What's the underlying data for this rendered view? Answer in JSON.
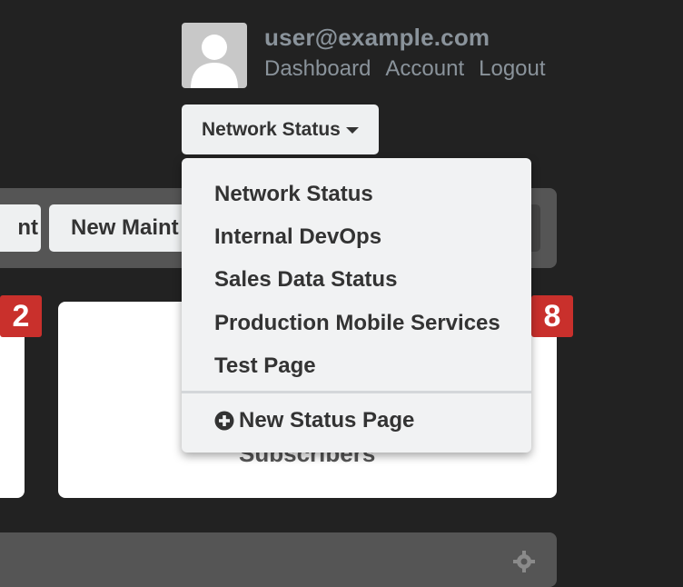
{
  "user": {
    "email": "user@example.com",
    "links": [
      "Dashboard",
      "Account",
      "Logout"
    ]
  },
  "status_selector": {
    "label": "Network Status"
  },
  "toolbar": {
    "buttons": [
      "nt",
      "New Maint"
    ]
  },
  "cards": {
    "right_label": "Subscribers"
  },
  "badges": [
    "2",
    "8"
  ],
  "dropdown": {
    "items": [
      "Network Status",
      "Internal DevOps",
      "Sales Data Status",
      "Production Mobile Services",
      "Test Page"
    ],
    "new_page": "New Status Page"
  },
  "colors": {
    "background": "#222222",
    "badge": "#c9302c",
    "link": "#8a939b",
    "panel": "#555555"
  },
  "icons": [
    "avatar-icon",
    "caret-down-icon",
    "plus-circle-icon",
    "gear-icon"
  ]
}
